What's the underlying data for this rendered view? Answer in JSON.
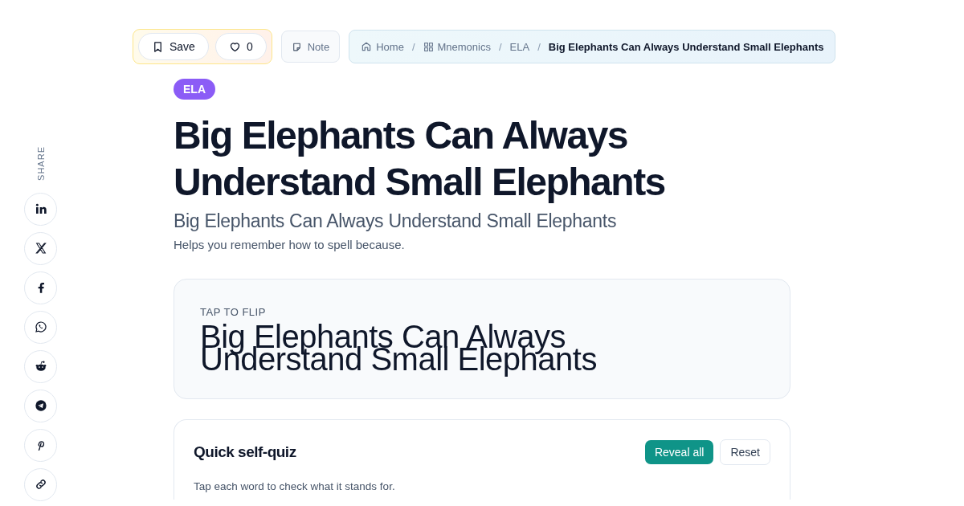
{
  "toolbar": {
    "save": {
      "label": "Save"
    },
    "like": {
      "count": "0"
    },
    "note": {
      "label": "Note"
    }
  },
  "breadcrumb": [
    {
      "kind": "home",
      "label": "Home",
      "current": false
    },
    {
      "kind": "grid",
      "separator": "/",
      "label": "Mnemonics",
      "current": false
    },
    {
      "kind": "plain",
      "separator": "/",
      "label": "ELA",
      "current": false
    },
    {
      "kind": "plain",
      "separator": "/",
      "label": "Big Elephants Can Always Understand Small Elephants",
      "current": true
    }
  ],
  "share": {
    "label": "SHARE",
    "items": [
      {
        "kind": "linkedin"
      },
      {
        "kind": "x"
      },
      {
        "kind": "facebook"
      },
      {
        "kind": "whatsapp"
      },
      {
        "kind": "reddit"
      },
      {
        "kind": "telegram"
      },
      {
        "kind": "pinterest"
      },
      {
        "kind": "link"
      }
    ]
  },
  "tag": "ELA",
  "title": "Big Elephants Can Always Understand Small Elephants",
  "subtitle": "Big Elephants Can Always Understand Small Elephants",
  "description": "Helps you remember how to spell because.",
  "flashcard": {
    "hint": "TAP TO FLIP",
    "text": "Big Elephants Can Always Understand Small Elephants"
  },
  "quiz": {
    "title": "Quick self-quiz",
    "reveal": "Reveal all",
    "reset": "Reset",
    "instructions": "Tap each word to check what it stands for."
  }
}
